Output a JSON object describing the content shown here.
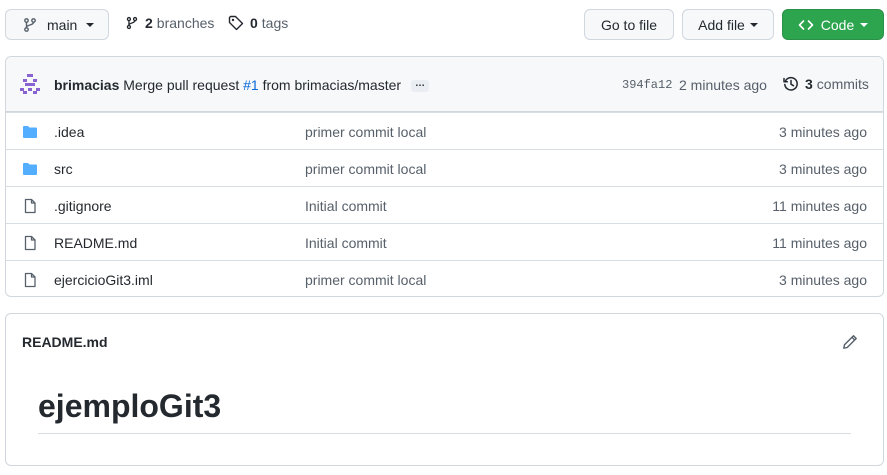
{
  "toolbar": {
    "branch": {
      "label": "main",
      "icon": "git-branch-icon"
    },
    "branches": {
      "count": "2",
      "label": "branches",
      "icon": "git-branch-icon"
    },
    "tags": {
      "count": "0",
      "label": "tags",
      "icon": "tag-icon"
    },
    "go_to_file": "Go to file",
    "add_file": "Add file",
    "code": "Code"
  },
  "commit": {
    "author": "brimacias",
    "message_prefix": "Merge pull request",
    "pr_link": "#1",
    "message_suffix": "from brimacias/master",
    "ellipsis": "…",
    "sha": "394fa12",
    "time": "2 minutes ago",
    "commits_count": "3",
    "commits_label": "commits"
  },
  "files": [
    {
      "name": ".idea",
      "type": "folder",
      "message": "primer commit local",
      "age": "3 minutes ago"
    },
    {
      "name": "src",
      "type": "folder",
      "message": "primer commit local",
      "age": "3 minutes ago"
    },
    {
      "name": ".gitignore",
      "type": "file",
      "message": "Initial commit",
      "age": "11 minutes ago"
    },
    {
      "name": "README.md",
      "type": "file",
      "message": "Initial commit",
      "age": "11 minutes ago"
    },
    {
      "name": "ejercicioGit3.iml",
      "type": "file",
      "message": "primer commit local",
      "age": "3 minutes ago"
    }
  ],
  "readme": {
    "title": "README.md",
    "heading": "ejemploGit3"
  },
  "colors": {
    "accent": "#0969da",
    "code_button": "#2da44e",
    "folder": "#54aeff"
  }
}
